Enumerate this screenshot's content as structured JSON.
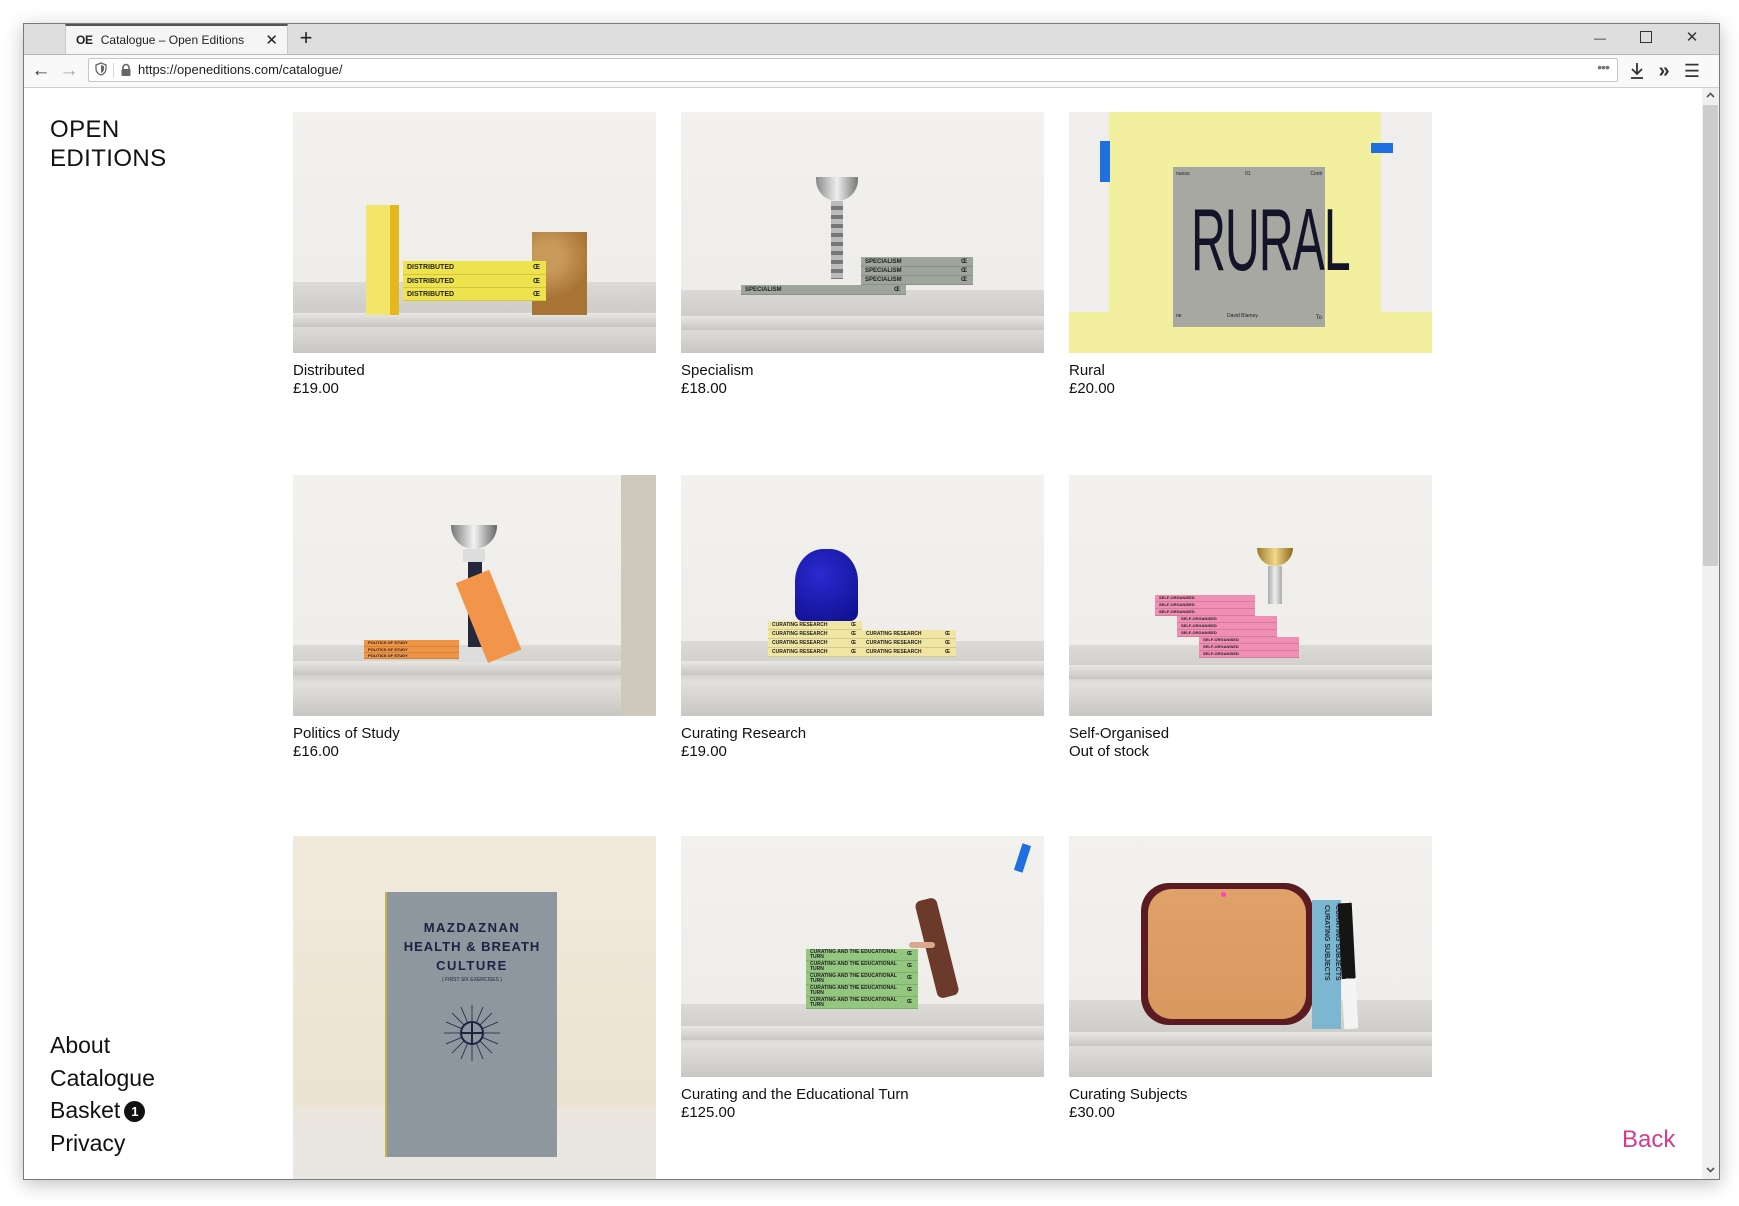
{
  "browser": {
    "tab": {
      "favicon_text": "OE",
      "title": "Catalogue – Open Editions"
    },
    "url": "https://openeditions.com/catalogue/",
    "icons": {
      "back": "←",
      "forward": "→",
      "new_tab": "+",
      "close_tab": "✕",
      "minimize": "—",
      "maximize": "☐",
      "close_window": "✕",
      "page_actions": "•••",
      "downloads": "⤓",
      "overflow": "»",
      "menu": "☰",
      "scroll_up": "▲",
      "scroll_down": "▼"
    }
  },
  "site": {
    "logo_line1": "OPEN",
    "logo_line2": "EDITIONS",
    "nav": {
      "about": "About",
      "catalogue": "Catalogue",
      "basket": "Basket",
      "basket_count": "1",
      "privacy": "Privacy"
    },
    "back_label": "Back",
    "accent_color": "#d63a8c"
  },
  "products": [
    {
      "title": "Distributed",
      "price": "£19.00",
      "spine": "DISTRIBUTED"
    },
    {
      "title": "Specialism",
      "price": "£18.00",
      "spine": "SPECIALISM"
    },
    {
      "title": "Rural",
      "price": "£20.00",
      "cover_title": "RURAL",
      "cover_author": "David Blamey",
      "cover_tl": "nuous",
      "cover_tc": "01",
      "cover_tr": "Conti",
      "cover_bl": "ne",
      "cover_br": "To"
    },
    {
      "title": "Politics of Study",
      "price": "£16.00",
      "spine": "POLITICS OF STUDY"
    },
    {
      "title": "Curating Research",
      "price": "£19.00",
      "spine": "CURATING RESEARCH"
    },
    {
      "title": "Self-Organised",
      "price": "Out of stock",
      "spine": "SELF-ORGANISED"
    },
    {
      "title": "Mazdaznan Health & Breath Culture",
      "price": "",
      "cover_l1": "MAZDAZNAN",
      "cover_l2": "HEALTH & BREATH",
      "cover_l3": "CULTURE",
      "cover_sub": "( FIRST SIX EXERCISES )"
    },
    {
      "title": "Curating and the Educational Turn",
      "price": "£125.00",
      "spine": "CURATING AND THE EDUCATIONAL TURN"
    },
    {
      "title": "Curating Subjects",
      "price": "£30.00",
      "spine": "CURATING SUBJECTS"
    }
  ],
  "oe_mark": "Œ"
}
